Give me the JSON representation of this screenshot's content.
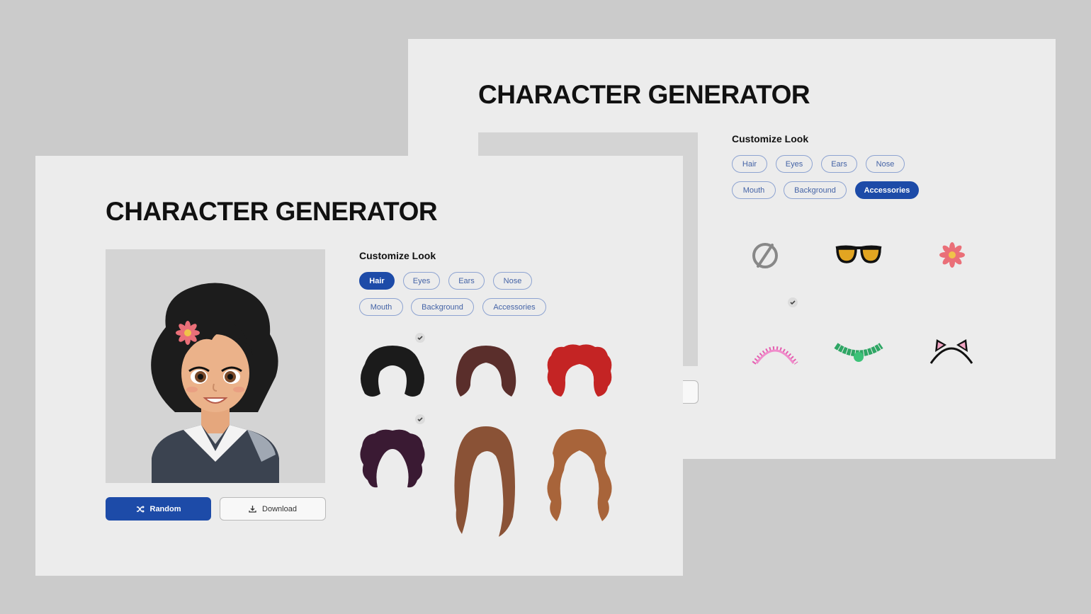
{
  "back_window": {
    "title": "CHARACTER GENERATOR",
    "section_label": "Customize Look",
    "tabs": [
      {
        "label": "Hair",
        "active": false
      },
      {
        "label": "Eyes",
        "active": false
      },
      {
        "label": "Ears",
        "active": false
      },
      {
        "label": "Nose",
        "active": false
      },
      {
        "label": "Mouth",
        "active": false
      },
      {
        "label": "Background",
        "active": false
      },
      {
        "label": "Accessories",
        "active": true
      }
    ],
    "options": [
      {
        "icon": "none-icon",
        "selected": false
      },
      {
        "icon": "sunglasses-icon",
        "selected": false
      },
      {
        "icon": "flower-icon",
        "selected": true
      },
      {
        "icon": "pearl-headband-icon",
        "selected": false
      },
      {
        "icon": "bead-necklace-icon",
        "selected": false
      },
      {
        "icon": "cat-ears-icon",
        "selected": false
      }
    ]
  },
  "front_window": {
    "title": "CHARACTER GENERATOR",
    "section_label": "Customize Look",
    "tabs": [
      {
        "label": "Hair",
        "active": true
      },
      {
        "label": "Eyes",
        "active": false
      },
      {
        "label": "Ears",
        "active": false
      },
      {
        "label": "Nose",
        "active": false
      },
      {
        "label": "Mouth",
        "active": false
      },
      {
        "label": "Background",
        "active": false
      },
      {
        "label": "Accessories",
        "active": false
      }
    ],
    "buttons": {
      "random_label": "Random",
      "download_label": "Download"
    },
    "options": [
      {
        "icon": "black-bob-hair-icon",
        "color": "#1b1b1b",
        "selected": true
      },
      {
        "icon": "brown-short-hair-icon",
        "color": "#5a2e2b",
        "selected": false
      },
      {
        "icon": "red-curly-hair-icon",
        "color": "#c42424",
        "selected": false
      },
      {
        "icon": "purple-curly-hair-icon",
        "color": "#3a1a33",
        "selected": true
      },
      {
        "icon": "long-straight-hair-icon",
        "color": "#8a5236",
        "selected": false
      },
      {
        "icon": "long-wavy-hair-icon",
        "color": "#a8643a",
        "selected": false
      }
    ]
  },
  "colors": {
    "accent": "#1d4ba8",
    "pill_border": "#8da3d1",
    "card_bg": "#ececec",
    "page_bg": "#cbcbcb"
  }
}
